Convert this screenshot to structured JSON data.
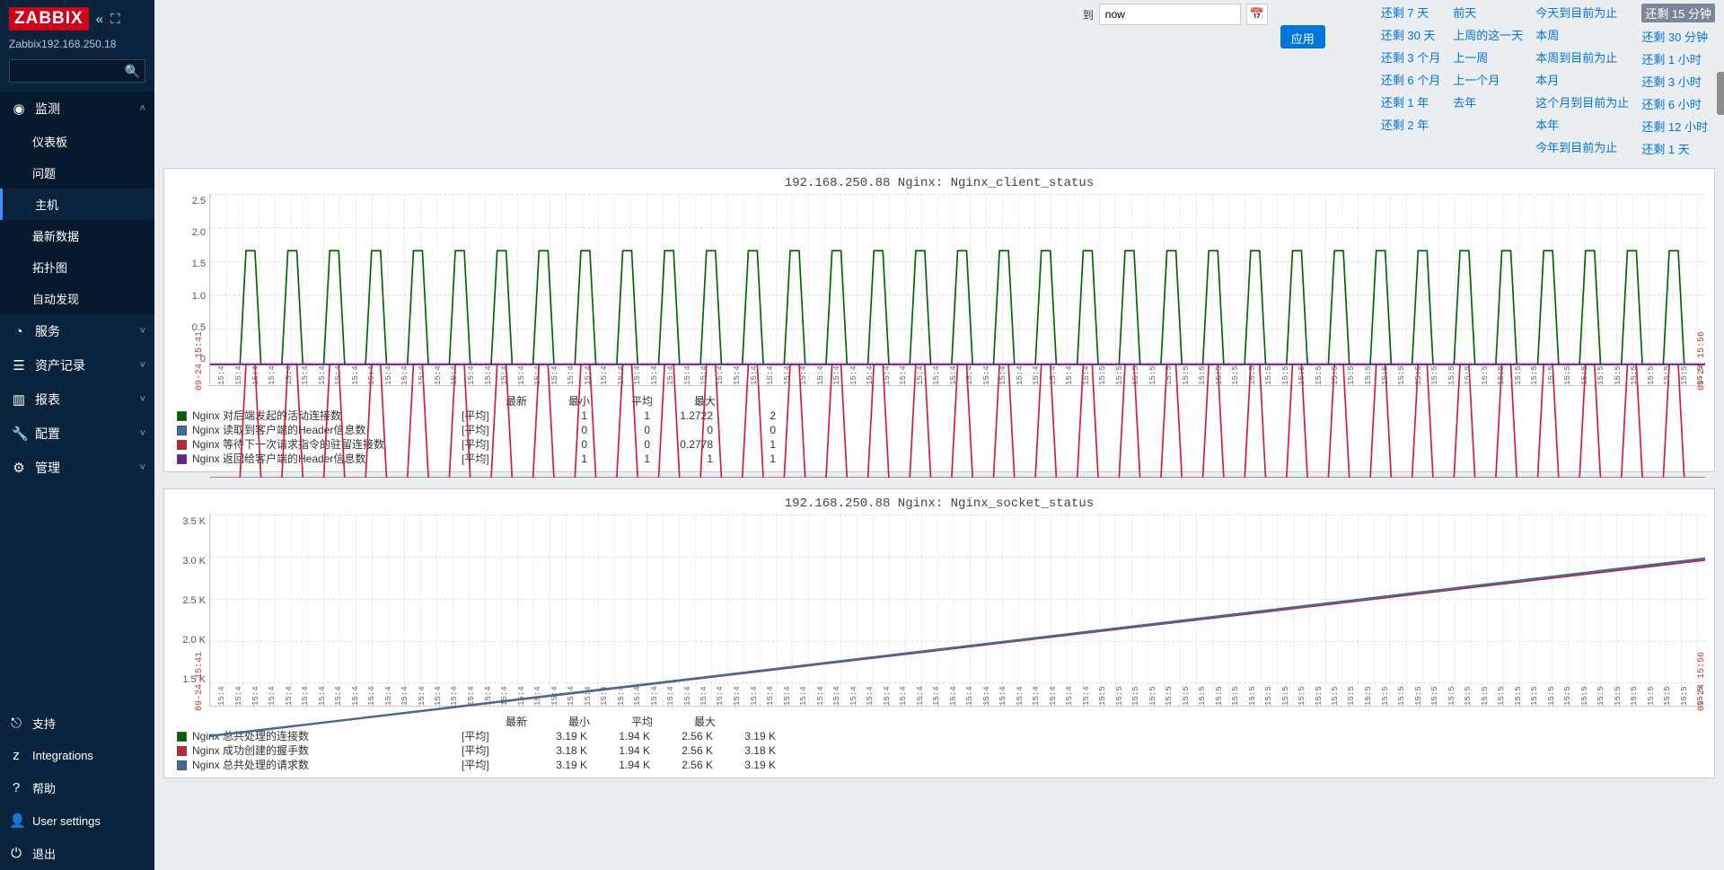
{
  "brand": "ZABBIX",
  "host_line": "Zabbix192.168.250.18",
  "search": {
    "placeholder": ""
  },
  "nav": {
    "monitor": "监测",
    "sub": [
      "仪表板",
      "问题",
      "主机",
      "最新数据",
      "拓扑图",
      "自动发现"
    ],
    "service": "服务",
    "asset": "资产记录",
    "report": "报表",
    "config": "配置",
    "admin": "管理"
  },
  "footer": [
    "支持",
    "Integrations",
    "帮助",
    "User settings",
    "退出"
  ],
  "top": {
    "to_label": "到",
    "to_value": "now",
    "apply": "应用"
  },
  "quick": {
    "col1": [
      "还剩 7 天",
      "还剩 30 天",
      "还剩 3 个月",
      "还剩 6 个月",
      "还剩 1 年",
      "还剩 2 年"
    ],
    "col2": [
      "前天",
      "上周的这一天",
      "上一周",
      "上一个月",
      "去年"
    ],
    "col3": [
      "今天到目前为止",
      "本周",
      "本周到目前为止",
      "本月",
      "这个月到目前为止",
      "本年",
      "今年到目前为止"
    ],
    "col4": [
      "还剩 15 分钟",
      "还剩 30 分钟",
      "还剩 1 小时",
      "还剩 3 小时",
      "还剩 6 小时",
      "还剩 12 小时",
      "还剩 1 天"
    ]
  },
  "charts": [
    {
      "title": "192.168.250.88 Nginx: Nginx_client_status",
      "chart_data": {
        "type": "line",
        "ylim": [
          0,
          2.5
        ],
        "yticks": [
          "2.5",
          "2.0",
          "1.5",
          "1.0",
          "0.5",
          "0"
        ],
        "x_start": "09-24 15:41",
        "x_end": "09-24 15:56",
        "series": [
          {
            "name": "Nginx 对后端发起的活动连接数",
            "color": "#006400",
            "baseline": 1,
            "spike": 2
          },
          {
            "name": "Nginx 读取到客户端的Header信息数",
            "color": "#3b6fa0",
            "baseline": 0,
            "spike": 0
          },
          {
            "name": "Nginx 等待下一次请求指令的驻留连接数",
            "color": "#d01c3a",
            "baseline": 0,
            "spike": 1
          },
          {
            "name": "Nginx 返回给客户端的Header信息数",
            "color": "#6a1b9a",
            "baseline": 1,
            "spike": 1
          }
        ]
      },
      "legend_header": [
        "最新",
        "最小",
        "平均",
        "最大"
      ],
      "legend": [
        {
          "sw": "#006400",
          "name": "Nginx 对后端发起的活动连接数",
          "mode": "[平均]",
          "v": [
            "1",
            "1",
            "1.2722",
            "2"
          ]
        },
        {
          "sw": "#3b6fa0",
          "name": "Nginx 读取到客户端的Header信息数",
          "mode": "[平均]",
          "v": [
            "0",
            "0",
            "0",
            "0"
          ]
        },
        {
          "sw": "#d01c3a",
          "name": "Nginx 等待下一次请求指令的驻留连接数",
          "mode": "[平均]",
          "v": [
            "0",
            "0",
            "0.2778",
            "1"
          ]
        },
        {
          "sw": "#6a1b9a",
          "name": "Nginx 返回给客户端的Header信息数",
          "mode": "[平均]",
          "v": [
            "1",
            "1",
            "1",
            "1"
          ]
        }
      ]
    },
    {
      "title": "192.168.250.88 Nginx: Nginx_socket_status",
      "chart_data": {
        "type": "line",
        "ylim": [
          1.5,
          3.5
        ],
        "yticks": [
          "3.5 K",
          "3.0 K",
          "2.5 K",
          "2.0 K",
          "1.5 K"
        ],
        "x_start": "09-24 15:41",
        "x_end": "09-24 15:56",
        "series": [
          {
            "name": "Nginx 总共处理的连接数",
            "color": "#006400",
            "start": 1.94,
            "end": 3.19
          },
          {
            "name": "Nginx 成功创建的握手数",
            "color": "#d01c3a",
            "start": 1.94,
            "end": 3.18
          },
          {
            "name": "Nginx 总共处理的请求数",
            "color": "#3b6fa0",
            "start": 1.94,
            "end": 3.19
          }
        ]
      },
      "legend_header": [
        "最新",
        "最小",
        "平均",
        "最大"
      ],
      "legend": [
        {
          "sw": "#006400",
          "name": "Nginx 总共处理的连接数",
          "mode": "[平均]",
          "v": [
            "3.19 K",
            "1.94 K",
            "2.56 K",
            "3.19 K"
          ]
        },
        {
          "sw": "#d01c3a",
          "name": "Nginx 成功创建的握手数",
          "mode": "[平均]",
          "v": [
            "3.18 K",
            "1.94 K",
            "2.56 K",
            "3.18 K"
          ]
        },
        {
          "sw": "#3b6fa0",
          "name": "Nginx 总共处理的请求数",
          "mode": "[平均]",
          "v": [
            "3.19 K",
            "1.94 K",
            "2.56 K",
            "3.19 K"
          ]
        }
      ]
    }
  ]
}
